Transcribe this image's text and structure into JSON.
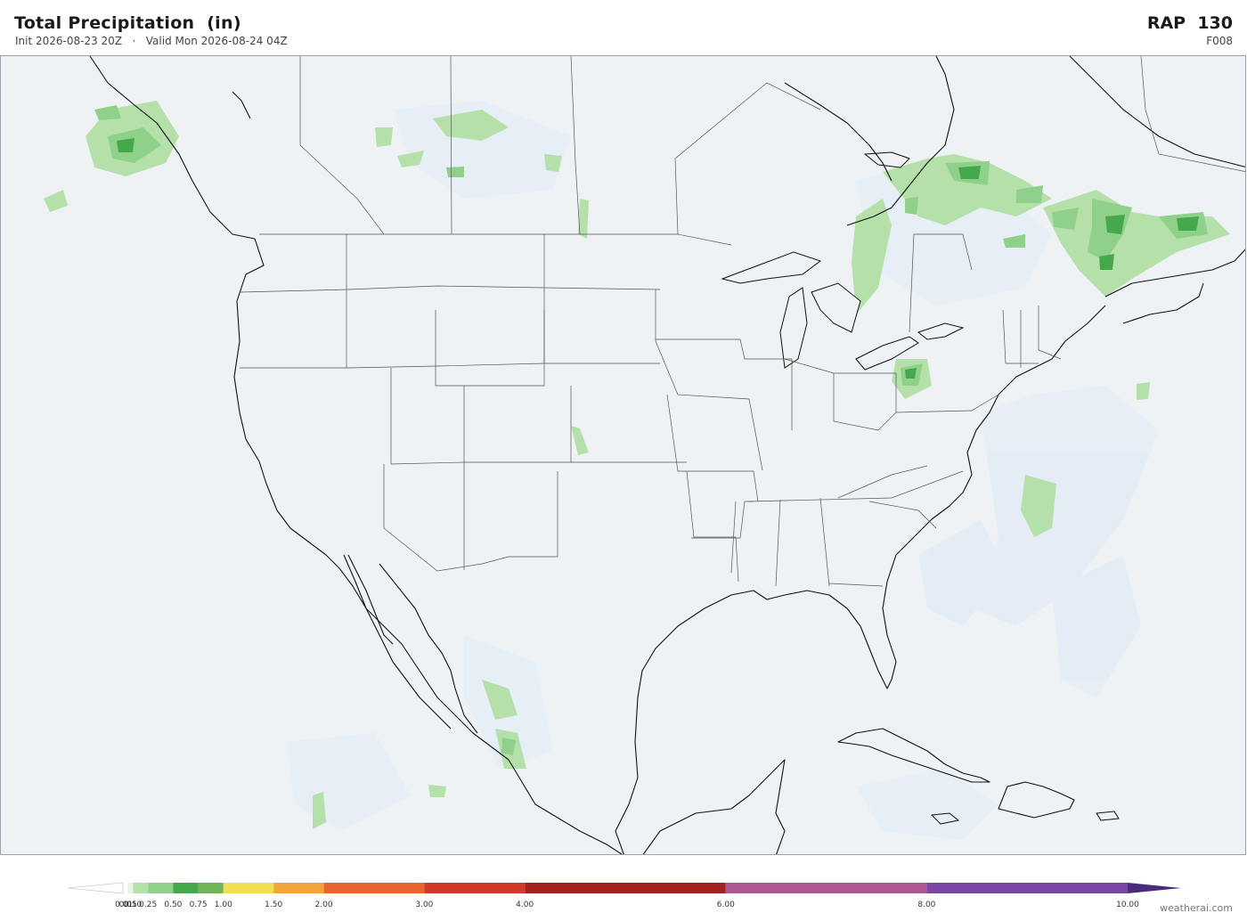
{
  "header": {
    "title": "Total Precipitation  (in)",
    "init": "Init 2026-08-23 20Z",
    "separator": "·",
    "valid": "Valid Mon 2026-08-24 04Z",
    "model": "RAP  130",
    "forecast_hour": "F008"
  },
  "legend": {
    "bins": [
      {
        "label": "0.01",
        "value": 0.01,
        "color": "#ffffff"
      },
      {
        "label": "0.05",
        "value": 0.05,
        "color": "#e6f5e1"
      },
      {
        "label": "0.10",
        "value": 0.1,
        "color": "#b5e0a9"
      },
      {
        "label": "0.25",
        "value": 0.25,
        "color": "#8fd18a"
      },
      {
        "label": "0.50",
        "value": 0.5,
        "color": "#45a94c"
      },
      {
        "label": "0.75",
        "value": 0.75,
        "color": "#72b355"
      },
      {
        "label": "1.00",
        "value": 1.0,
        "color": "#f2dd56"
      },
      {
        "label": "1.50",
        "value": 1.5,
        "color": "#f0a43b"
      },
      {
        "label": "2.00",
        "value": 2.0,
        "color": "#e5672f"
      },
      {
        "label": "3.00",
        "value": 3.0,
        "color": "#d03a28"
      },
      {
        "label": "4.00",
        "value": 4.0,
        "color": "#a02320"
      },
      {
        "label": "6.00",
        "value": 6.0,
        "color": "#ae5893"
      },
      {
        "label": "8.00",
        "value": 8.0,
        "color": "#7b46a4"
      },
      {
        "label": "10.00",
        "value": 10.0,
        "color": "#4a2b79"
      }
    ],
    "ticks": [
      "0.01",
      "0.05",
      "0.10",
      "0.25",
      "0.50",
      "0.75",
      "1.00",
      "1.50",
      "2.00",
      "3.00",
      "4.00",
      "6.00",
      "8.00",
      "10.00"
    ]
  },
  "credit": "weatherai.com",
  "colors": {
    "land": "#eef2f5",
    "coast": "#111111",
    "border": "#555555",
    "light_precip": "#e6eef6",
    "green_light": "#b5e0a9",
    "green_mid": "#8fd18a",
    "green_dark": "#45a94c"
  }
}
